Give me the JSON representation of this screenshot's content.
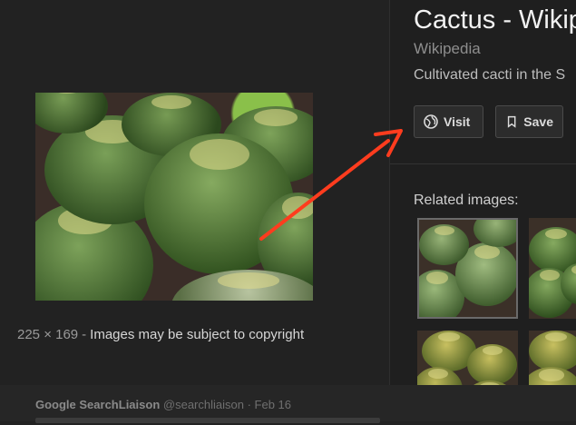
{
  "image": {
    "dimensions": "225 × 169",
    "separator": "-",
    "copyright_note": "Images may be subject to copyright"
  },
  "panel": {
    "title": "Cactus - Wikip",
    "source": "Wikipedia",
    "caption": "Cultivated cacti in the S",
    "visit_label": "Visit",
    "save_label": "Save",
    "related_label": "Related images:"
  },
  "tweet": {
    "author": "Google SearchLiaison",
    "handle": "@searchliaison",
    "date": "· Feb 16"
  },
  "colors": {
    "background": "#222222",
    "arrow": "#ff3c1e",
    "cactus_green": "#4f7a34"
  },
  "icons": {
    "visit": "globe-icon",
    "save": "bookmark-icon"
  }
}
